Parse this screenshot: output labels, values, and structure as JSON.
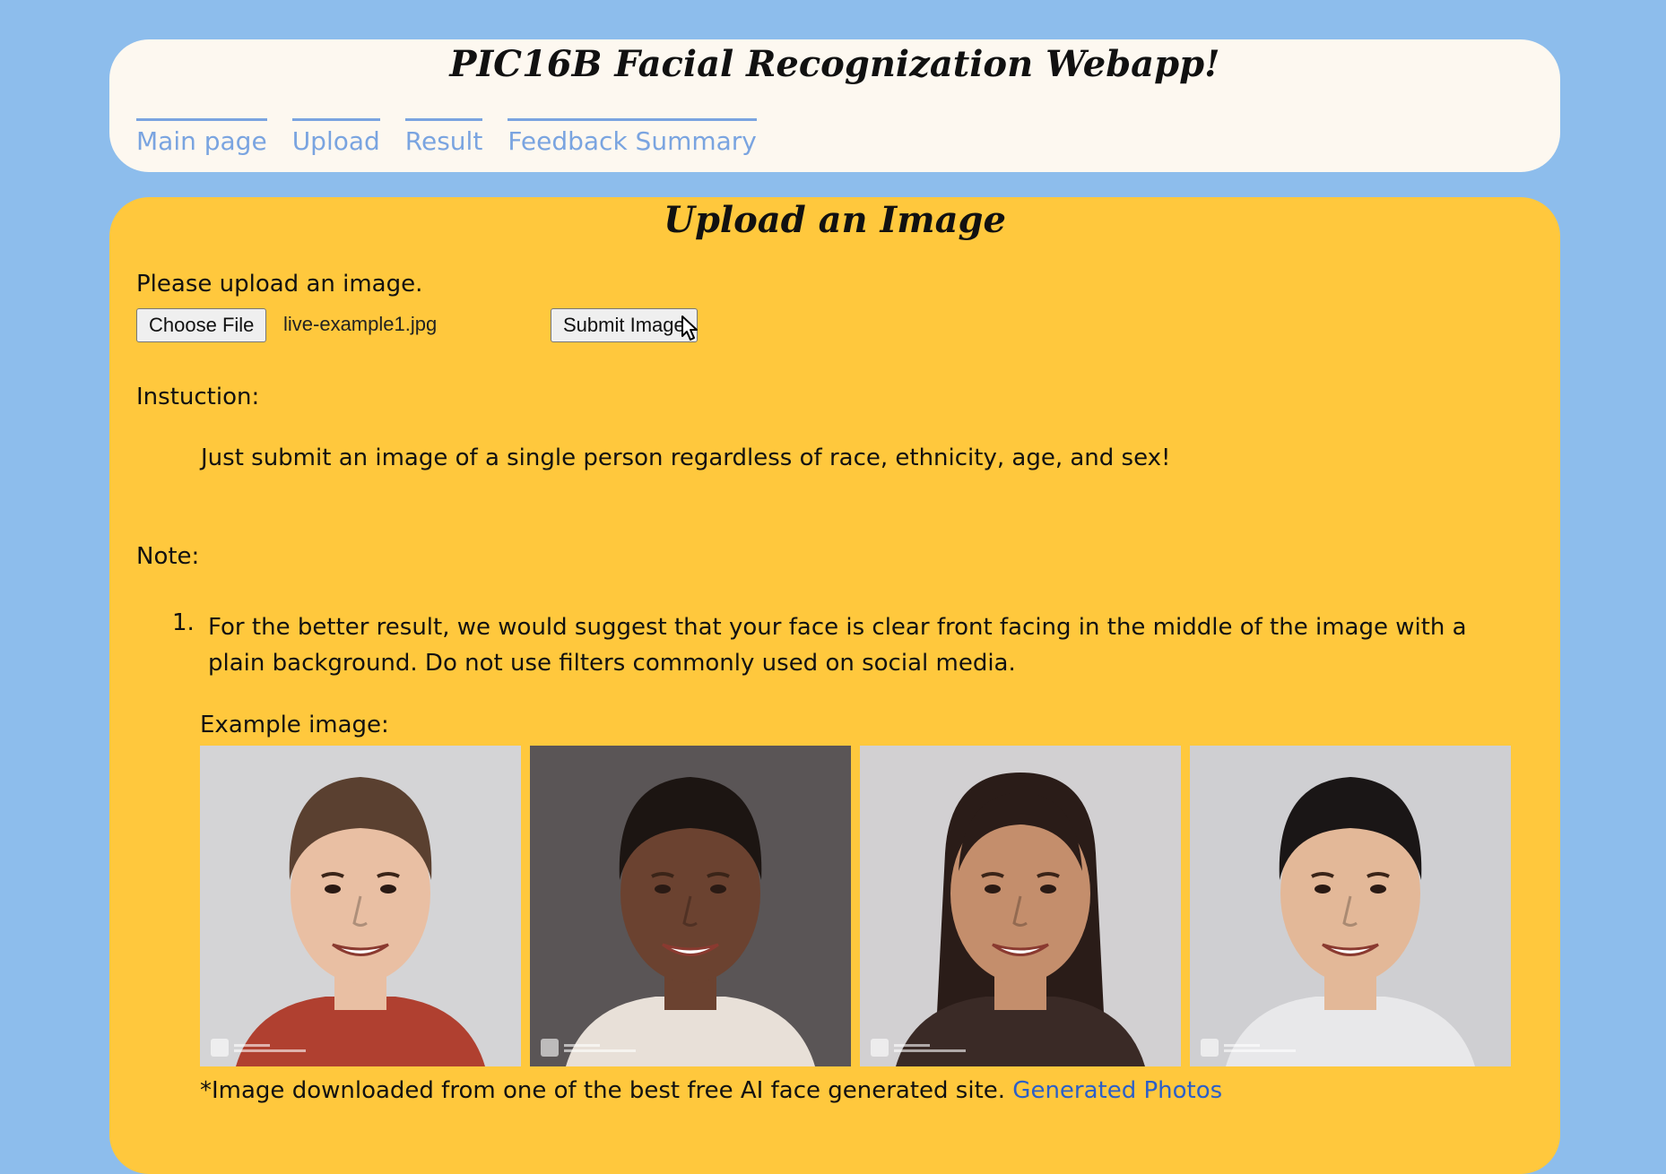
{
  "header": {
    "title": "PIC16B Facial Recognization Webapp!",
    "nav": [
      {
        "label": "Main page"
      },
      {
        "label": "Upload"
      },
      {
        "label": "Result"
      },
      {
        "label": "Feedback Summary"
      }
    ]
  },
  "upload": {
    "heading": "Upload an Image",
    "prompt": "Please upload an image.",
    "choose_file_label": "Choose File",
    "file_name": "live-example1.jpg",
    "submit_label": "Submit Image"
  },
  "instruction": {
    "label": "Instuction:",
    "text": "Just submit an image of a single person regardless of race, ethnicity, age, and sex!"
  },
  "note": {
    "label": "Note:",
    "items": [
      {
        "number": "1.",
        "text": "For the better result, we would suggest that your face is clear front facing in the middle of the image with a plain background. Do not use filters commonly used on social media."
      }
    ],
    "example_label": "Example image:"
  },
  "examples": [
    {
      "name": "young-man",
      "bg": "#d4d4d6",
      "skin": "#e9bfa3",
      "hair": "#5a4030",
      "shirt": "#b04030"
    },
    {
      "name": "woman-dark",
      "bg": "#5a5556",
      "skin": "#6b4230",
      "hair": "#1c1512",
      "shirt": "#e8e0d8"
    },
    {
      "name": "woman-long-hair",
      "bg": "#d2d0d2",
      "skin": "#c48e6c",
      "hair": "#2a1c18",
      "shirt": "#3a2a26"
    },
    {
      "name": "man-short-hair",
      "bg": "#cfcfd2",
      "skin": "#e3b898",
      "hair": "#1a1616",
      "shirt": "#e8e8ea"
    }
  ],
  "footnote": {
    "text": "*Image downloaded from one of the best free AI face generated site. ",
    "link_label": "Generated Photos"
  }
}
